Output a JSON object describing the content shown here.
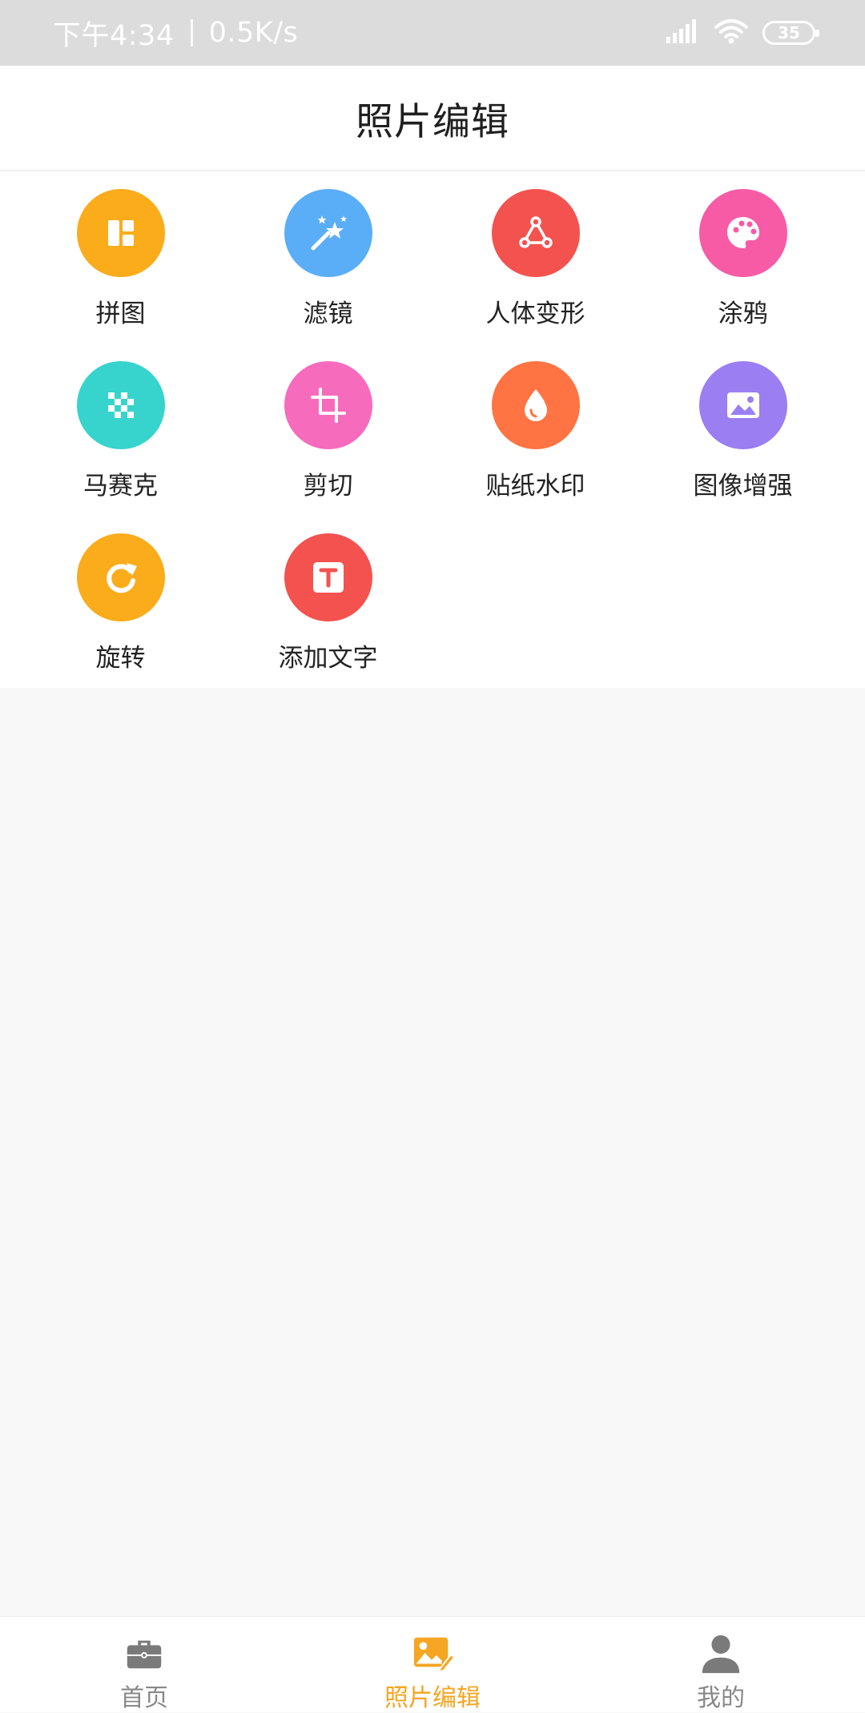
{
  "status_bar": {
    "time": "下午4:34",
    "speed": "0.5K/s",
    "battery": "35"
  },
  "header": {
    "title": "照片编辑"
  },
  "tools": [
    {
      "label": "拼图",
      "icon": "collage-icon",
      "color": "#fbac1b"
    },
    {
      "label": "滤镜",
      "icon": "magic-wand-icon",
      "color": "#5aaef7"
    },
    {
      "label": "人体变形",
      "icon": "body-reshape-icon",
      "color": "#f4524f"
    },
    {
      "label": "涂鸦",
      "icon": "palette-icon",
      "color": "#f75ba6"
    },
    {
      "label": "马赛克",
      "icon": "mosaic-icon",
      "color": "#36d4cc"
    },
    {
      "label": "剪切",
      "icon": "crop-icon",
      "color": "#f76bbd"
    },
    {
      "label": "贴纸水印",
      "icon": "droplet-icon",
      "color": "#ff7442"
    },
    {
      "label": "图像增强",
      "icon": "image-enhance-icon",
      "color": "#9b7ef1"
    },
    {
      "label": "旋转",
      "icon": "rotate-icon",
      "color": "#fbac1b"
    },
    {
      "label": "添加文字",
      "icon": "text-icon",
      "color": "#f4524f"
    }
  ],
  "bottom_nav": [
    {
      "label": "首页",
      "icon": "briefcase-icon",
      "active": false
    },
    {
      "label": "照片编辑",
      "icon": "photo-edit-icon",
      "active": true
    },
    {
      "label": "我的",
      "icon": "user-icon",
      "active": false
    }
  ],
  "colors": {
    "accent": "#f5a623",
    "inactive": "#888888"
  }
}
